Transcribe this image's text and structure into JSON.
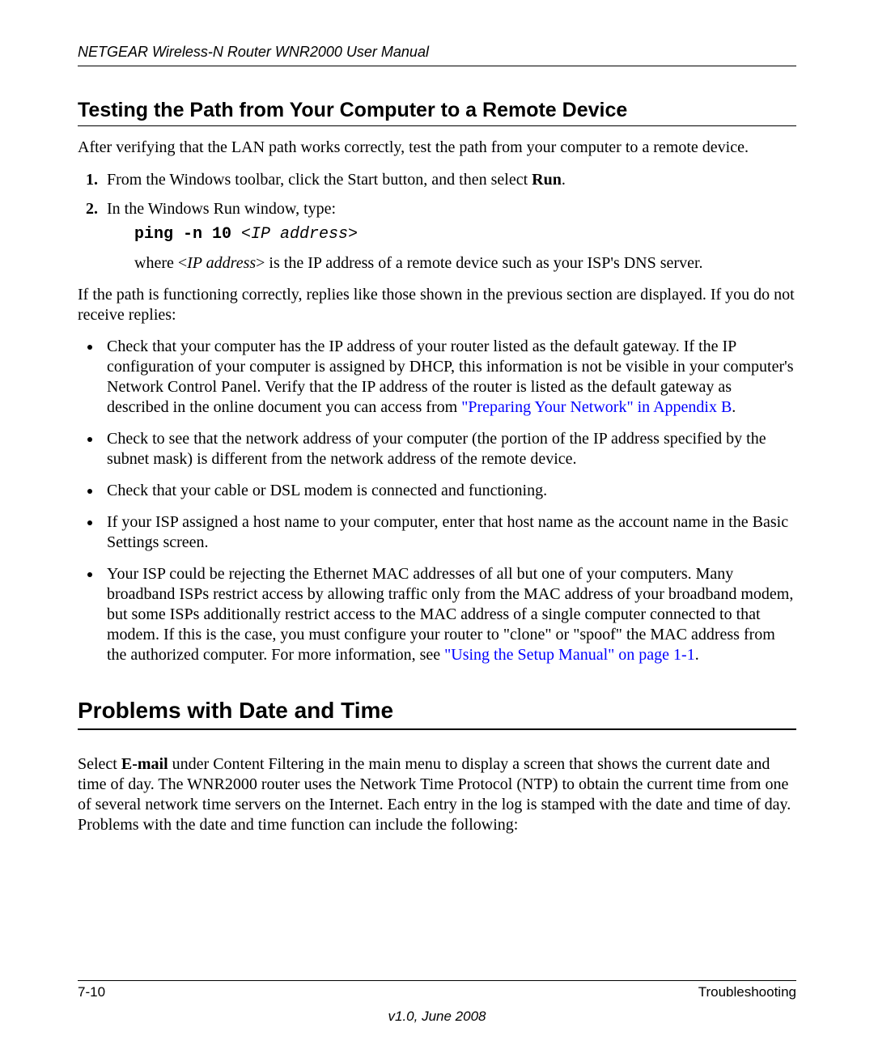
{
  "header": {
    "running_title": "NETGEAR Wireless-N Router WNR2000 User Manual"
  },
  "section1": {
    "heading": "Testing the Path from Your Computer to a Remote Device",
    "intro": "After verifying that the LAN path works correctly, test the path from your computer to a remote device.",
    "step1_pre": "From the Windows toolbar, click the Start button, and then select ",
    "step1_bold": "Run",
    "step1_post": ".",
    "step2_line1": "In the Windows Run window, type:",
    "step2_code_cmd": "ping -n 10 ",
    "step2_code_arg": "<IP address>",
    "step2_explain_pre": "where <",
    "step2_explain_ital": "IP address",
    "step2_explain_post": "> is the IP address of a remote device such as your ISP's DNS server.",
    "after_steps": "If the path is functioning correctly, replies like those shown in the previous section are displayed. If you do not receive replies:",
    "bullet1_pre": "Check that your computer has the IP address of your router listed as the default gateway. If the IP configuration of your computer is assigned by DHCP, this information is not be visible in your computer's Network Control Panel. Verify that the IP address of the router is listed as the default gateway as described in the online document you can access from ",
    "bullet1_link": "\"Preparing Your Network\" in Appendix B",
    "bullet1_post": ".",
    "bullet2": "Check to see that the network address of your computer (the portion of the IP address specified by the subnet mask) is different from the network address of the remote device.",
    "bullet3": "Check that your cable or DSL modem is connected and functioning.",
    "bullet4": "If your ISP assigned a host name to your computer, enter that host name as the account name in the Basic Settings screen.",
    "bullet5_pre": "Your ISP could be rejecting the Ethernet MAC addresses of all but one of your computers. Many broadband ISPs restrict access by allowing traffic only from the MAC address of your broadband modem, but some ISPs additionally restrict access to the MAC address of a single computer connected to that modem. If this is the case, you must configure your router to \"clone\" or \"spoof\" the MAC address from the authorized computer. For more information, see ",
    "bullet5_link": "\"Using the Setup Manual\" on page 1-1",
    "bullet5_post": "."
  },
  "section2": {
    "heading": "Problems with Date and Time",
    "p1_pre": "Select ",
    "p1_bold": "E-mail",
    "p1_post": " under Content Filtering in the main menu to display a screen that shows the current date and time of day. The WNR2000 router uses the Network Time Protocol (NTP) to obtain the current time from one of several network time servers on the Internet. Each entry in the log is stamped with the date and time of day. Problems with the date and time function can include the following:"
  },
  "footer": {
    "page_num": "7-10",
    "chapter": "Troubleshooting",
    "version": "v1.0, June 2008"
  }
}
